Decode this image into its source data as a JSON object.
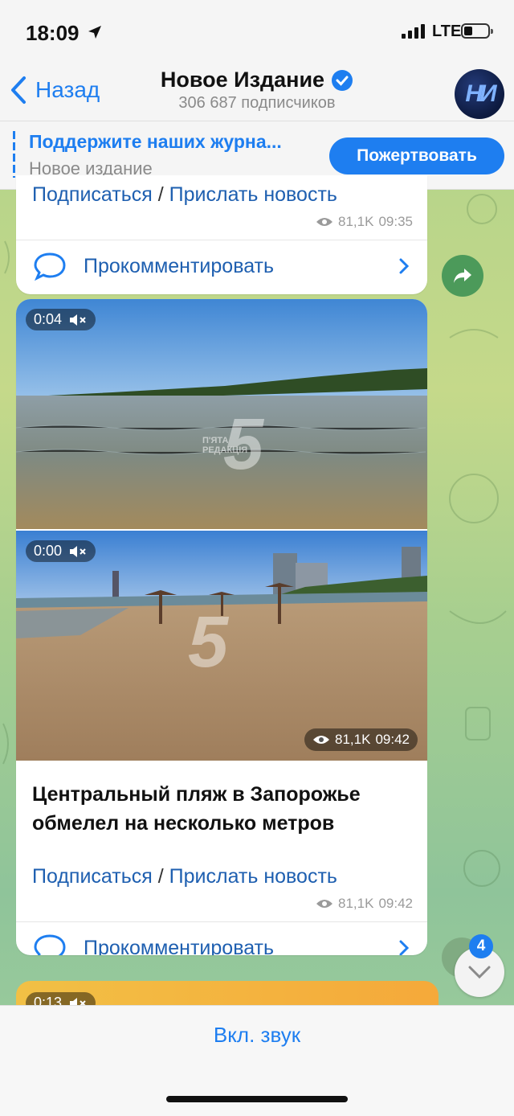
{
  "status_bar": {
    "time": "18:09",
    "network": "LTE",
    "battery_level": 0.35
  },
  "header": {
    "back_label": "Назад",
    "channel_title": "Новое Издание",
    "subscribers": "306 687 подписчиков",
    "avatar_text": "НИ"
  },
  "pinned": {
    "title": "Поддержите наших журна...",
    "subtitle": "Новое издание",
    "donate_label": "Пожертвовать"
  },
  "post_top": {
    "links": {
      "subscribe": "Подписаться",
      "separator": "/",
      "send_news": "Прислать новость"
    },
    "views": "81,1K",
    "time": "09:35",
    "comment_label": "Прокомментировать"
  },
  "post_main": {
    "video1_duration": "0:04",
    "video2_duration": "0:00",
    "video_views": "81,1K",
    "video_time": "09:42",
    "watermark": "5",
    "watermark_caption": "П'ЯТА РЕДАКЦІЯ",
    "text": "Центральный пляж в Запорожье обмелел на несколько метров",
    "links": {
      "subscribe": "Подписаться",
      "separator": "/",
      "send_news": "Прислать новость"
    },
    "views": "81,1K",
    "time": "09:42",
    "comment_label": "Прокомментировать"
  },
  "post_next": {
    "video_duration": "0:13"
  },
  "unread_count": "4",
  "bottom": {
    "sound_label": "Вкл. звук"
  }
}
